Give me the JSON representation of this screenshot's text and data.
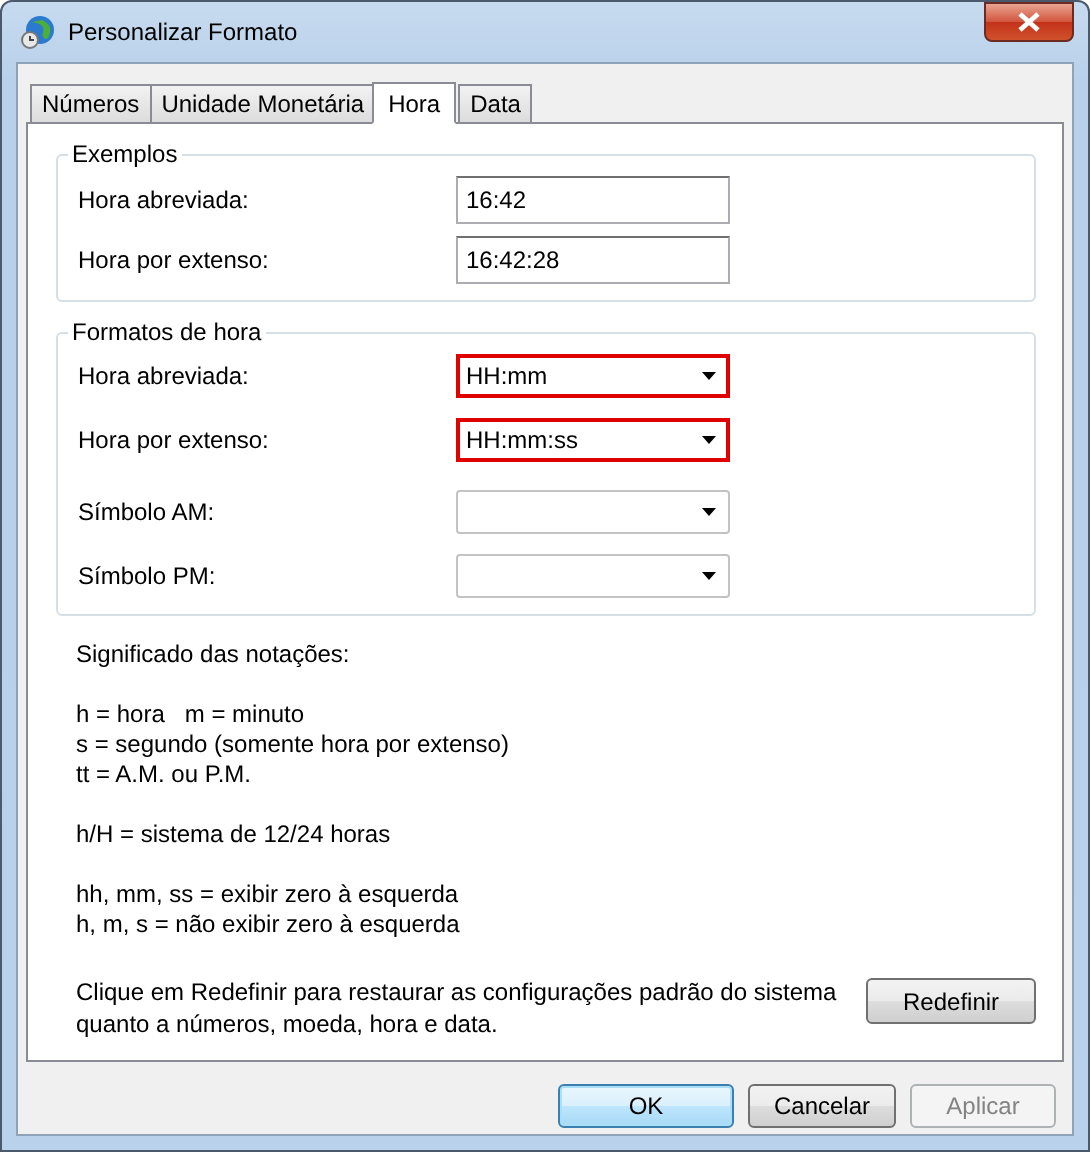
{
  "window": {
    "title": "Personalizar Formato"
  },
  "tabs": [
    {
      "label": "Números",
      "selected": false
    },
    {
      "label": "Unidade Monetária",
      "selected": false
    },
    {
      "label": "Hora",
      "selected": true
    },
    {
      "label": "Data",
      "selected": false
    }
  ],
  "examples": {
    "title": "Exemplos",
    "rows": [
      {
        "label": "Hora abreviada:",
        "value": "16:42"
      },
      {
        "label": "Hora por extenso:",
        "value": "16:42:28"
      }
    ]
  },
  "formats": {
    "title": "Formatos de hora",
    "rows": [
      {
        "label": "Hora abreviada:",
        "value": "HH:mm",
        "highlighted": true
      },
      {
        "label": "Hora por extenso:",
        "value": "HH:mm:ss",
        "highlighted": true
      },
      {
        "label": "Símbolo AM:",
        "highlighted": false
      },
      {
        "label": "Símbolo PM:",
        "highlighted": false
      }
    ]
  },
  "notes": {
    "title": "Significado das notações:",
    "groups": [
      [
        "h = hora   m = minuto",
        "s = segundo (somente hora por extenso)",
        "tt = A.M. ou P.M."
      ],
      [
        "h/H = sistema de 12/24 horas"
      ],
      [
        "hh, mm, ss = exibir zero à esquerda",
        "h, m, s = não exibir zero à esquerda"
      ]
    ]
  },
  "reset": {
    "text": "Clique em Redefinir para restaurar as configurações padrão do sistema quanto a números, moeda, hora e data.",
    "button": "Redefinir"
  },
  "buttons": [
    {
      "label": "OK",
      "focused": true,
      "disabled": false
    },
    {
      "label": "Cancelar",
      "focused": false,
      "disabled": false
    },
    {
      "label": "Aplicar",
      "focused": false,
      "disabled": true
    }
  ]
}
